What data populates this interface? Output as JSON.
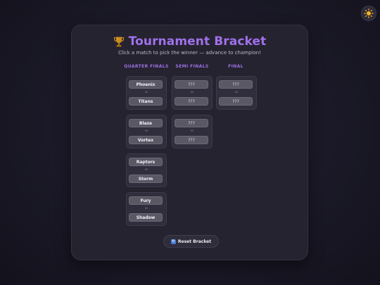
{
  "theme_toggle": {
    "icon": "sun-icon"
  },
  "header": {
    "icon": "trophy-icon",
    "title": "Tournament Bracket",
    "subtitle": "Click a match to pick the winner — advance to champion!"
  },
  "columns": [
    {
      "label": "QUARTER FINALS"
    },
    {
      "label": "SEMI FINALS"
    },
    {
      "label": "FINAL"
    }
  ],
  "vs_label": "vs",
  "quarter_finals": [
    {
      "team1": "Phoenix",
      "team2": "Titans"
    },
    {
      "team1": "Blaze",
      "team2": "Vortex"
    },
    {
      "team1": "Raptors",
      "team2": "Storm"
    },
    {
      "team1": "Fury",
      "team2": "Shadow"
    }
  ],
  "semi_finals": [
    {
      "team1": "???",
      "team2": "???"
    },
    {
      "team1": "???",
      "team2": "???"
    }
  ],
  "final": [
    {
      "team1": "???",
      "team2": "???"
    }
  ],
  "reset_button": {
    "icon": "refresh-icon",
    "label": "Reset Bracket"
  },
  "colors": {
    "accent": "#a071ec",
    "background": "#1c1a29",
    "card": "#25232f"
  }
}
